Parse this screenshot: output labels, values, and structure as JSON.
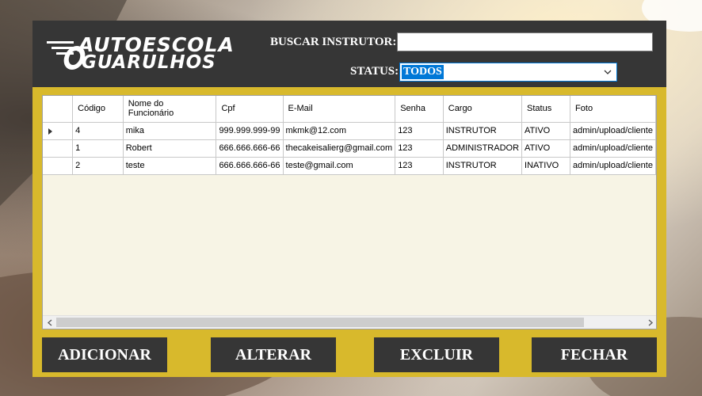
{
  "logo": {
    "line1": "AUTOESCOLA",
    "line2": "GUARULHOS"
  },
  "search": {
    "label": "BUSCAR INSTRUTOR:",
    "value": ""
  },
  "status": {
    "label": "STATUS:",
    "selected": "TODOS"
  },
  "grid": {
    "columns": [
      "Código",
      "Nome do Funcionário",
      "Cpf",
      "E-Mail",
      "Senha",
      "Cargo",
      "Status",
      "Foto"
    ],
    "rows": [
      [
        "4",
        "mika",
        "999.999.999-99",
        "mkmk@12.com",
        "123",
        "INSTRUTOR",
        "ATIVO",
        "admin/upload/cliente"
      ],
      [
        "1",
        "Robert",
        "666.666.666-66",
        "thecakeisalierg@gmail.com",
        "123",
        "ADMINISTRADOR",
        "ATIVO",
        "admin/upload/cliente"
      ],
      [
        "2",
        "teste",
        "666.666.666-66",
        "teste@gmail.com",
        "123",
        "INSTRUTOR",
        "INATIVO",
        "admin/upload/cliente"
      ]
    ]
  },
  "buttons": {
    "add": "ADICIONAR",
    "edit": "ALTERAR",
    "delete": "EXCLUIR",
    "close": "FECHAR"
  },
  "colors": {
    "header": "#363636",
    "accent": "#d8b92c",
    "selection": "#0078d7"
  }
}
